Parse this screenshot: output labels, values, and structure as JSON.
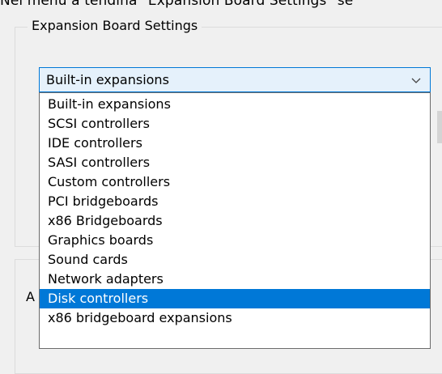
{
  "header_clipped_text": "Nel menù a tendina \"Expansion Board Settings\" se",
  "group": {
    "title": "Expansion Board Settings",
    "second_title_fragment": "A"
  },
  "combo": {
    "selected": "Built-in expansions",
    "arrow_icon": "chevron-down-icon"
  },
  "dropdown": {
    "options": [
      "Built-in expansions",
      "SCSI controllers",
      "IDE controllers",
      "SASI controllers",
      "Custom controllers",
      "PCI bridgeboards",
      "x86 Bridgeboards",
      "Graphics boards",
      "Sound cards",
      "Network adapters",
      "Disk controllers",
      "x86 bridgeboard expansions"
    ],
    "highlighted": "Disk controllers"
  },
  "colors": {
    "highlight": "#0078d7",
    "combo_bg": "#e5f1fb",
    "window_bg": "#f0f0f0"
  }
}
